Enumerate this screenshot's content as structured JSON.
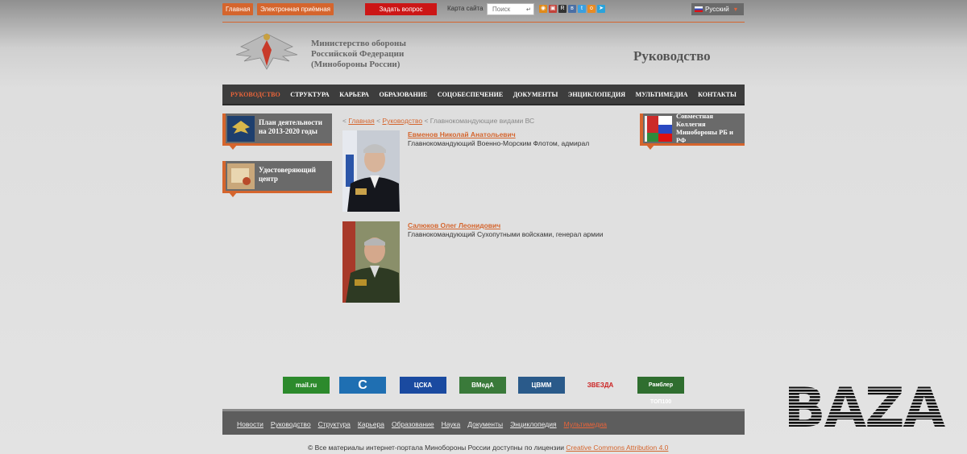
{
  "topbar": {
    "home": "Главная",
    "reception": "Электронная приёмная",
    "ask": "Задать вопрос",
    "sitemap": "Карта сайта",
    "search_placeholder": "Поиск",
    "language": "Русский"
  },
  "header": {
    "ministry_line1": "Министерство обороны",
    "ministry_line2": "Российской Федерации",
    "ministry_line3": "(Минобороны России)",
    "page_title": "Руководство"
  },
  "nav": {
    "items": [
      "РУКОВОДСТВО",
      "СТРУКТУРА",
      "КАРЬЕРА",
      "ОБРАЗОВАНИЕ",
      "СОЦОБЕСПЕЧЕНИЕ",
      "ДОКУМЕНТЫ",
      "ЭНЦИКЛОПЕДИЯ",
      "МУЛЬТИМЕДИА",
      "КОНТАКТЫ"
    ]
  },
  "left_banners": [
    {
      "text1": "План деятельности",
      "text2": "на 2013-2020 годы"
    },
    {
      "text1": "Удостоверяющий",
      "text2": "центр"
    }
  ],
  "right_banner": {
    "text1": "Совместная",
    "text2": "Коллегия",
    "text3": "Минобороны РБ и",
    "text4": "РФ"
  },
  "breadcrumb": {
    "prefix": "<",
    "home": "Главная",
    "sep": "<",
    "section": "Руководство",
    "current": "< Главнокомандующие видами ВС"
  },
  "persons": [
    {
      "name": "Евменов Николай Анатольевич",
      "title": "Главнокомандующий Военно-Морским Флотом, адмирал"
    },
    {
      "name": "Салюков Олег Леонидович",
      "title": "Главнокомандующий Сухопутными войсками, генерал армии"
    }
  ],
  "partners": [
    {
      "label": "mail.ru",
      "color": "#2c8a2c"
    },
    {
      "label": "C",
      "color": "#1f6fb2"
    },
    {
      "label": "ЦСКА",
      "color": "#1a4aa0"
    },
    {
      "label": "ВМедА",
      "color": "#3a7a3a"
    },
    {
      "label": "ЦВММ",
      "color": "#2a5a8a"
    },
    {
      "label": "ЗВЕЗДА",
      "color": "#cc2222"
    },
    {
      "label": "Рамблер ТОП100",
      "color": "#2f6e2f"
    }
  ],
  "footer": {
    "links": [
      "Новости",
      "Руководство",
      "Структура",
      "Карьера",
      "Образование",
      "Наука",
      "Документы",
      "Энциклопедия"
    ],
    "highlight_links": [
      "Мультимедиа"
    ],
    "copyright": "© Все материалы интернет-портала Минобороны России доступны по лицензии",
    "license": "Creative Commons Attribution 4.0"
  },
  "watermark": "BAZA",
  "colors": {
    "accent": "#d5652d",
    "nav_bg": "#3d3d3d",
    "ask": "#cc1616"
  }
}
